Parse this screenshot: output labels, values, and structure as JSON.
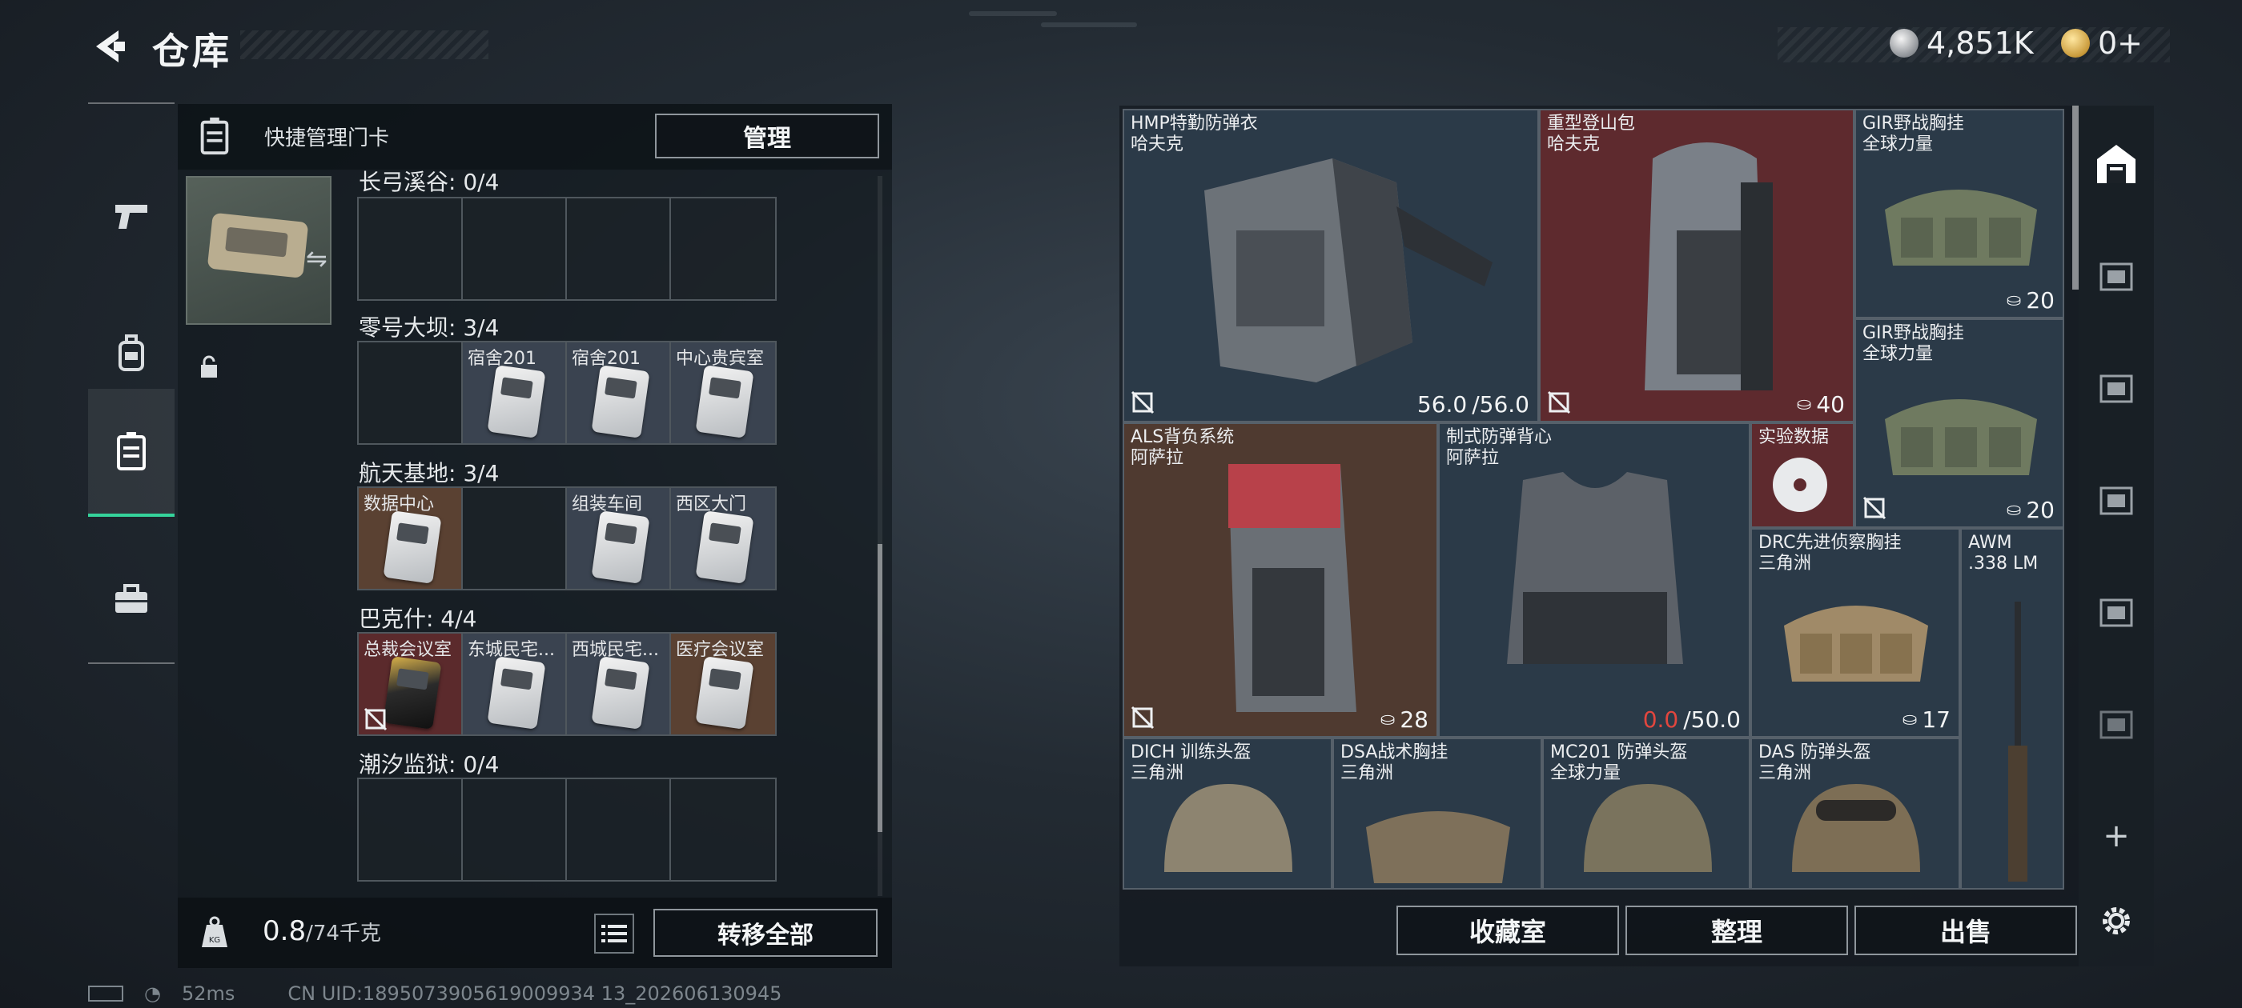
{
  "header": {
    "title": "仓库",
    "currency_silver": "4,851K",
    "currency_gold": "0+"
  },
  "card_panel": {
    "header_label": "快捷管理门卡",
    "manage_label": "管理",
    "regions": [
      {
        "label": "长弓溪谷: 0/4",
        "slots": [
          "",
          "",
          "",
          ""
        ]
      },
      {
        "label": "零号大坝: 3/4",
        "slots": [
          "",
          "宿舍201",
          "宿舍201",
          "中心贵宾室"
        ]
      },
      {
        "label": "航天基地: 3/4",
        "slots": [
          "数据中心",
          "",
          "组装车间",
          "西区大门"
        ]
      },
      {
        "label": "巴克什: 4/4",
        "slots": [
          "总裁会议室",
          "东城民宅...",
          "西城民宅...",
          "医疗会议室"
        ]
      },
      {
        "label": "潮汐监狱: 0/4",
        "slots": [
          "",
          "",
          "",
          ""
        ]
      }
    ],
    "weight_value": "0.8",
    "weight_max": "/74千克",
    "transfer_all_label": "转移全部"
  },
  "stash": {
    "items": {
      "hmp": {
        "name": "HMP特勤防弹衣",
        "brand": "哈夫克",
        "durability_current": "56.0",
        "durability_max": "/56.0"
      },
      "mountain_pack": {
        "name": "重型登山包",
        "brand": "哈夫克",
        "capacity": "40"
      },
      "gir1": {
        "name": "GIR野战胸挂",
        "brand": "全球力量",
        "capacity": "20"
      },
      "gir2": {
        "name": "GIR野战胸挂",
        "brand": "全球力量",
        "capacity": "20"
      },
      "als": {
        "name": "ALS背负系统",
        "brand": "阿萨拉",
        "capacity": "28"
      },
      "vest": {
        "name": "制式防弹背心",
        "brand": "阿萨拉",
        "durability_current": "0.0",
        "durability_max": "/50.0"
      },
      "data": {
        "name": "实验数据"
      },
      "drc": {
        "name": "DRC先进侦察胸挂",
        "brand": "三角洲",
        "capacity": "17"
      },
      "awm": {
        "name": "AWM",
        "brand": ".338 LM"
      },
      "dich": {
        "name": "DICH 训练头盔",
        "brand": "三角洲"
      },
      "dsa": {
        "name": "DSA战术胸挂",
        "brand": "三角洲"
      },
      "mc201": {
        "name": "MC201 防弹头盔",
        "brand": "全球力量"
      },
      "das": {
        "name": "DAS 防弹头盔",
        "brand": "三角洲"
      }
    },
    "collection_label": "收藏室",
    "sort_label": "整理",
    "sell_label": "出售"
  },
  "status_bar": {
    "ping": "52ms",
    "uid": "CN UID:1895073905619009934 13_202606130945"
  }
}
